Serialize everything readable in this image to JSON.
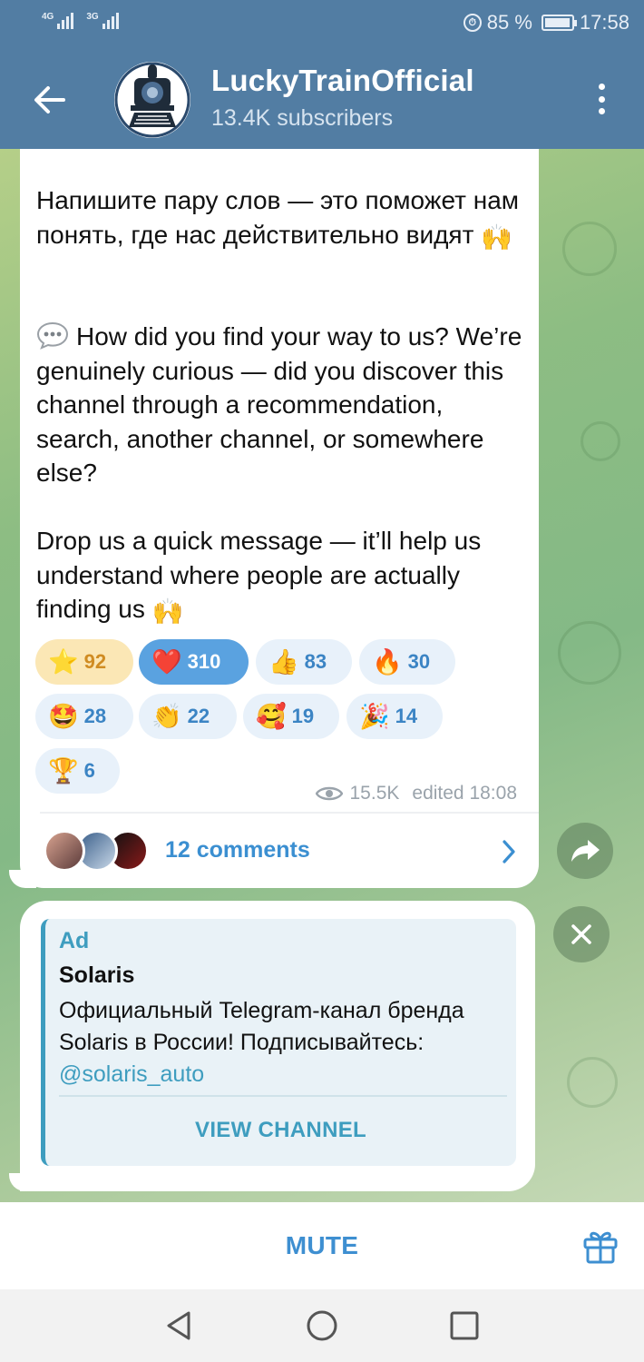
{
  "status_bar": {
    "signal1_tag": "4G",
    "signal2_tag": "3G",
    "alarm_icon": "alarm-icon",
    "battery_percent": "85 %",
    "battery_level": 0.85,
    "time": "17:58"
  },
  "header": {
    "channel_name": "LuckyTrainOfficial",
    "subscribers": "13.4K subscribers",
    "back_icon": "back-arrow-icon",
    "menu_icon": "more-vertical-icon"
  },
  "message": {
    "paragraph_ru": "Напишите пару слов — это поможет нам понять, где нас действительно видят",
    "emoji_raising_hands": "🙌",
    "speech_icon": "speech-bubble-icon",
    "paragraph_en_1": "How did you find your way to us? We’re genuinely curious — did you discover this channel through a recommendation, search, another channel, or somewhere else?",
    "paragraph_en_2": "Drop us a quick message — it’ll help us understand where people are actually finding us",
    "reactions": [
      {
        "emoji": "⭐",
        "count": "92",
        "kind": "star"
      },
      {
        "emoji": "❤️",
        "count": "310",
        "kind": "heart",
        "selected": true
      },
      {
        "emoji": "👍",
        "count": "83",
        "kind": "thumbs-up"
      },
      {
        "emoji": "🔥",
        "count": "30",
        "kind": "fire"
      },
      {
        "emoji": "🤩",
        "count": "28",
        "kind": "star-struck"
      },
      {
        "emoji": "👏",
        "count": "22",
        "kind": "clap"
      },
      {
        "emoji": "🥰",
        "count": "19",
        "kind": "smiling-hearts"
      },
      {
        "emoji": "🎉",
        "count": "14",
        "kind": "party-popper"
      },
      {
        "emoji": "🏆",
        "count": "6",
        "kind": "trophy"
      }
    ],
    "views": "15.5K",
    "edited": "edited 18:08",
    "comments": "12 comments"
  },
  "ad": {
    "label": "Ad",
    "name": "Solaris",
    "body": "Официальный Telegram-канал бренда Solaris в России! Подписывайтесь: ",
    "link": "@solaris_auto",
    "button": "VIEW CHANNEL"
  },
  "bottom": {
    "mute": "MUTE",
    "gift_icon": "gift-icon"
  },
  "colors": {
    "header": "#527da3",
    "accent": "#3e8fd1",
    "ad_accent": "#3e9dbf",
    "reaction_selected": "#5aa2e0"
  }
}
